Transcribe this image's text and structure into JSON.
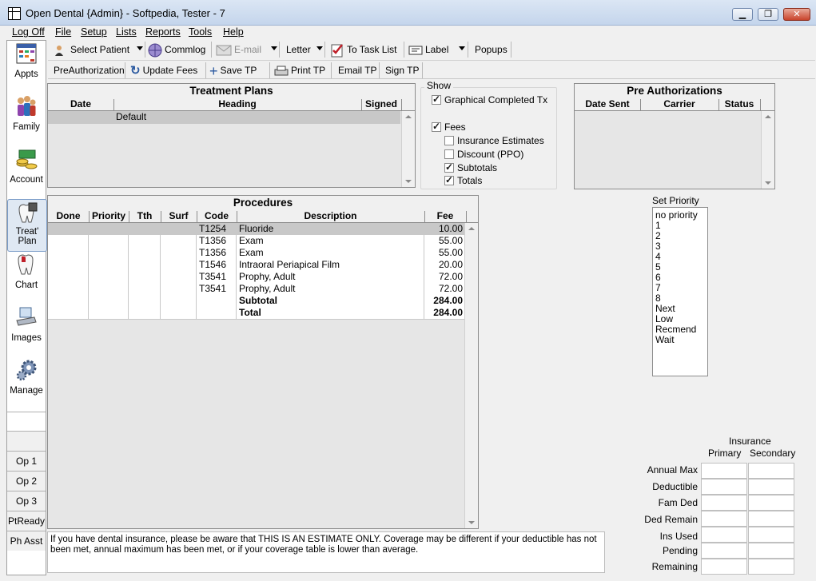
{
  "window": {
    "title": "Open Dental {Admin} - Softpedia, Tester - 7",
    "controls": {
      "minimize": "▁",
      "maximize": "❐",
      "close": "✕"
    }
  },
  "menu": [
    "Log Off",
    "File",
    "Setup",
    "Lists",
    "Reports",
    "Tools",
    "Help"
  ],
  "sidebar": {
    "modules": [
      {
        "label": "Appts",
        "icon": "calendar-icon"
      },
      {
        "label": "Family",
        "icon": "family-icon"
      },
      {
        "label": "Account",
        "icon": "money-icon"
      },
      {
        "label": "Treat' Plan",
        "icon": "tooth-treatment-icon",
        "selected": true
      },
      {
        "label": "Chart",
        "icon": "tooth-chart-icon"
      },
      {
        "label": "Images",
        "icon": "scanner-icon"
      },
      {
        "label": "Manage",
        "icon": "gears-icon"
      }
    ],
    "ops": [
      "",
      "",
      "Op 1",
      "Op 2",
      "Op 3",
      "PtReady",
      "Ph Asst"
    ]
  },
  "toolbar1": {
    "select_patient": "Select Patient",
    "commlog": "Commlog",
    "email": "E-mail",
    "letter": "Letter",
    "task_list": "To Task List",
    "label": "Label",
    "popups": "Popups"
  },
  "toolbar2": {
    "preauth": "PreAuthorization",
    "update_fees": "Update Fees",
    "save_tp": "Save TP",
    "print_tp": "Print TP",
    "email_tp": "Email TP",
    "sign_tp": "Sign TP"
  },
  "treatment_plans": {
    "title": "Treatment Plans",
    "columns": [
      "Date",
      "Heading",
      "Signed"
    ],
    "rows": [
      {
        "date": "",
        "heading": "Default",
        "signed": ""
      }
    ]
  },
  "show": {
    "title": "Show",
    "options": [
      {
        "label": "Graphical Completed Tx",
        "checked": true
      },
      {
        "label": "Fees",
        "checked": true
      },
      {
        "label": "Insurance Estimates",
        "checked": false
      },
      {
        "label": "Discount (PPO)",
        "checked": false
      },
      {
        "label": "Subtotals",
        "checked": true
      },
      {
        "label": "Totals",
        "checked": true
      }
    ]
  },
  "pre_authorizations": {
    "title": "Pre Authorizations",
    "columns": [
      "Date Sent",
      "Carrier",
      "Status"
    ]
  },
  "procedures": {
    "title": "Procedures",
    "columns": [
      "Done",
      "Priority",
      "Tth",
      "Surf",
      "Code",
      "Description",
      "Fee"
    ],
    "rows": [
      {
        "code": "T1254",
        "desc": "Fluoride",
        "fee": "10.00"
      },
      {
        "code": "T1356",
        "desc": "Exam",
        "fee": "55.00"
      },
      {
        "code": "T1356",
        "desc": "Exam",
        "fee": "55.00"
      },
      {
        "code": "T1546",
        "desc": "Intraoral Periapical Film",
        "fee": "20.00"
      },
      {
        "code": "T3541",
        "desc": "Prophy, Adult",
        "fee": "72.00"
      },
      {
        "code": "T3541",
        "desc": "Prophy, Adult",
        "fee": "72.00"
      }
    ],
    "subtotal_label": "Subtotal",
    "subtotal": "284.00",
    "total_label": "Total",
    "total": "284.00"
  },
  "set_priority": {
    "label": "Set Priority",
    "items": [
      "no priority",
      "1",
      "2",
      "3",
      "4",
      "5",
      "6",
      "7",
      "8",
      "Next",
      "Low",
      "Recmend",
      "Wait"
    ]
  },
  "insurance": {
    "header": "Insurance",
    "primary": "Primary",
    "secondary": "Secondary",
    "rows": [
      "Annual Max",
      "Deductible",
      "Fam Ded",
      "Ded Remain",
      "Ins Used",
      "Pending",
      "Remaining"
    ]
  },
  "note": "If you have dental insurance, please be aware that THIS IS AN ESTIMATE ONLY.  Coverage may be different if your deductible has not been met, annual maximum has been met, or if your coverage table is lower than average."
}
